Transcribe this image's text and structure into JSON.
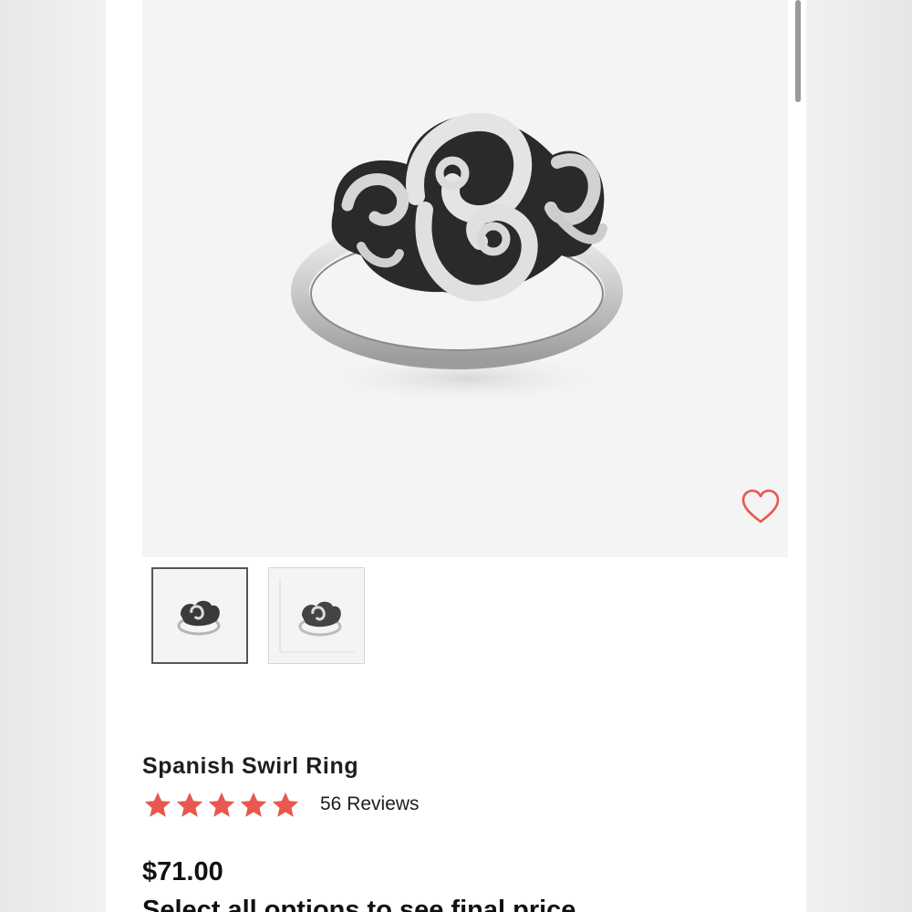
{
  "product": {
    "name": "Spanish Swirl Ring",
    "reviews_label": "56 Reviews",
    "rating": 5,
    "rating_max": 5,
    "price": "$71.00",
    "price_notice": "Select all options to see final price"
  },
  "gallery": {
    "thumbnails": [
      {
        "icon": "ring-thumbnail",
        "selected": true
      },
      {
        "icon": "ring-with-size-chart-thumbnail",
        "selected": false
      }
    ],
    "favorite_icon": "heart-icon"
  },
  "colors": {
    "accent": "#e8584e",
    "text": "#1e1e1e",
    "image_background": "#f4f4f4"
  }
}
